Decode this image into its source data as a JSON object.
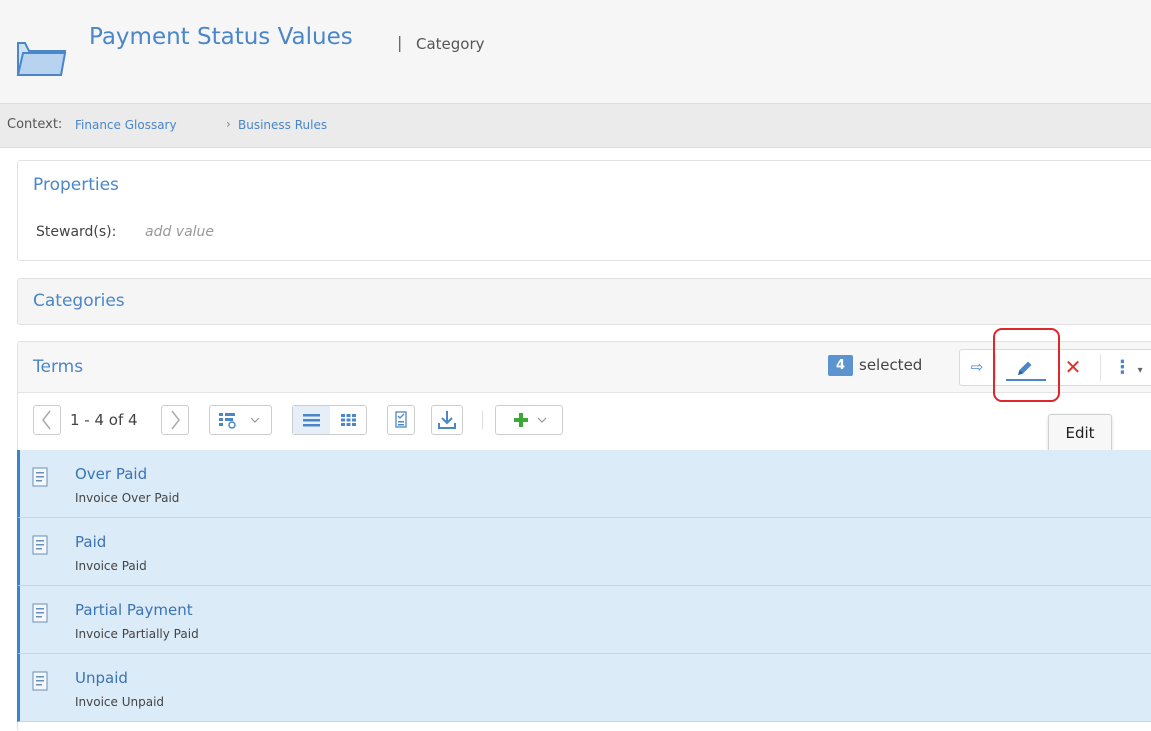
{
  "header": {
    "title": "Payment Status Values",
    "separator": "|",
    "type_label": "Category"
  },
  "context": {
    "label": "Context:",
    "glossary": "Finance Glossary",
    "separator": "›",
    "crumb": "Business Rules"
  },
  "properties": {
    "title": "Properties",
    "steward_label": "Steward(s):",
    "steward_placeholder": "add value"
  },
  "categories": {
    "title": "Categories"
  },
  "terms": {
    "title": "Terms",
    "selected_count": "4",
    "selected_label": "selected",
    "tooltip": "Edit",
    "pager": "1 - 4 of 4",
    "items": [
      {
        "name": "Over Paid",
        "description": "Invoice Over Paid"
      },
      {
        "name": "Paid",
        "description": "Invoice Paid"
      },
      {
        "name": "Partial Payment",
        "description": "Invoice Partially Paid"
      },
      {
        "name": "Unpaid",
        "description": "Invoice Unpaid"
      }
    ]
  },
  "colors": {
    "accent": "#4a86c8",
    "selection_bg": "#dcebf8",
    "delete": "#d9342b",
    "add": "#3aa935",
    "highlight": "#e0262d"
  }
}
